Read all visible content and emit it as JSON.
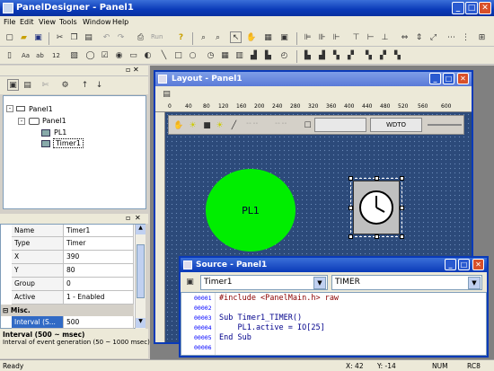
{
  "app": {
    "title": "PanelDesigner - Panel1"
  },
  "window_controls": {
    "minimize": "_",
    "maximize": "□",
    "close": "✕"
  },
  "menu": [
    "File",
    "Edit",
    "View",
    "Tools",
    "Window",
    "Help"
  ],
  "toolbar1": {
    "run_label": "Run"
  },
  "tree": {
    "root": "Panel1",
    "child": "Panel1",
    "items": [
      "PL1",
      "Timer1"
    ],
    "selected": "Timer1"
  },
  "properties": {
    "rows": [
      {
        "name": "Name",
        "value": "Timer1"
      },
      {
        "name": "Type",
        "value": "Timer"
      },
      {
        "name": "X",
        "value": "390"
      },
      {
        "name": "Y",
        "value": "80"
      },
      {
        "name": "Group",
        "value": "0"
      },
      {
        "name": "Active",
        "value": "1 - Enabled"
      }
    ],
    "category": "Misc.",
    "interval_name": "Interval (S...",
    "interval_value": "500",
    "help_title": "Interval (500 ~ msec)",
    "help_text": "Interval of event generation (50 ~ 1000 msec)"
  },
  "layout_window": {
    "title": "Layout - Panel1",
    "ruler_ticks": [
      "0",
      "40",
      "80",
      "120",
      "160",
      "200",
      "240",
      "280",
      "320",
      "360",
      "400",
      "440",
      "480",
      "520",
      "560",
      "600"
    ],
    "wdt_label": "WDTO",
    "circle_label": "PL1"
  },
  "source_window": {
    "title": "Source - Panel1",
    "object_combo": "Timer1",
    "event_combo": "TIMER",
    "line_numbers": [
      "00001",
      "00002",
      "00003",
      "00004",
      "00005",
      "00006"
    ],
    "lines": [
      "#include <PanelMain.h> raw",
      "",
      "Sub Timer1_TIMER()",
      "    PL1.active = IO[25]",
      "End Sub",
      ""
    ]
  },
  "status": {
    "left": "Ready",
    "coords": "X:  42",
    "y_coord": "Y:  -14",
    "num": "NUM",
    "rc": "RC8"
  },
  "colors": {
    "title_blue": "#0a3ab8",
    "canvas": "#2c4a7a",
    "circle_green": "#00ee00",
    "keyword": "#00008b",
    "selection": "#316ac5"
  }
}
